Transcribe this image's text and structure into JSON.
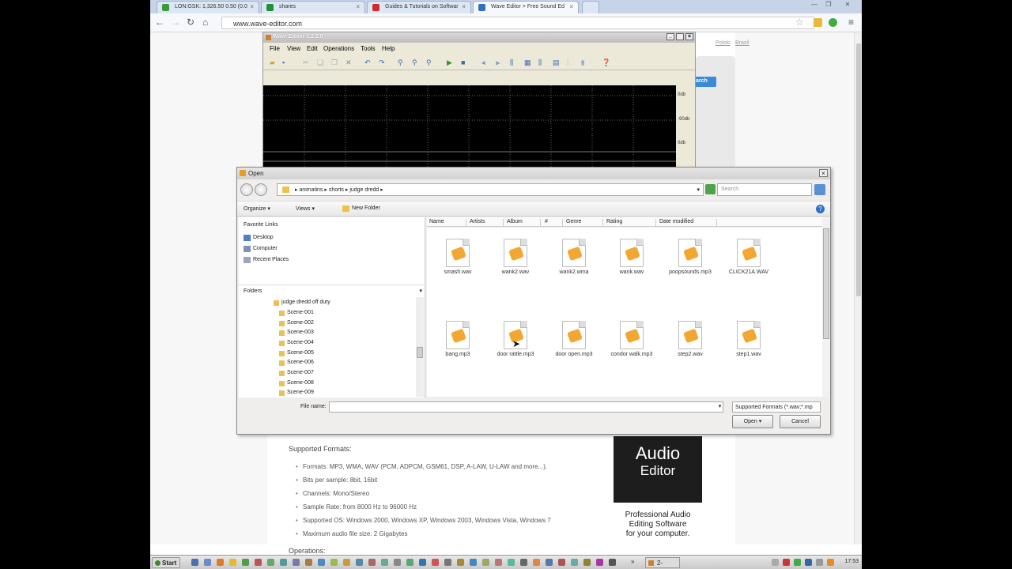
{
  "browser": {
    "tabs": [
      {
        "label": "LON:GSK: 1,326.50 0.50 (0.0",
        "favicon_color": "#3c9a3c"
      },
      {
        "label": "shares",
        "favicon_color": "#1f8f3a"
      },
      {
        "label": "Guides & Tutorials on Softwar",
        "favicon_color": "#d22a2a"
      },
      {
        "label": "Wave Editor > Free Sound Ed",
        "favicon_color": "#2f6fc9"
      }
    ],
    "url": "www.wave-editor.com",
    "page_links": {
      "lang1": "Polski",
      "lang2": "Brazil",
      "search_btn": "arch"
    }
  },
  "wave_editor": {
    "title": "Wave Editor 3.2.1.0",
    "menu": [
      "File",
      "View",
      "Edit",
      "Operations",
      "Tools",
      "Help"
    ],
    "db_labels": [
      "0db",
      "-90db",
      "0db"
    ]
  },
  "open_dialog": {
    "title": "Open",
    "breadcrumb": [
      "animatins",
      "shorts",
      "judge dredd"
    ],
    "search_placeholder": "Search",
    "commands": {
      "organize": "Organize",
      "views": "Views",
      "new_folder": "New Folder"
    },
    "favorite_links_header": "Favorite Links",
    "favorite_links": [
      "Desktop",
      "Computer",
      "Recent Places"
    ],
    "folders_header": "Folders",
    "folders": [
      "judge dredd off duty",
      "Scene-001",
      "Scene-002",
      "Scene-003",
      "Scene-004",
      "Scene-005",
      "Scene-006",
      "Scene-007",
      "Scene-008",
      "Scene-009"
    ],
    "columns": [
      "Name",
      "Artists",
      "Album",
      "#",
      "Genre",
      "Rating",
      "Date modified"
    ],
    "files_row1": [
      "smash.wav",
      "wank2.wav",
      "wank2.wma",
      "wank.wav",
      "poopsounds.mp3",
      "CLICK21A.WAV"
    ],
    "files_row2": [
      "bang.mp3",
      "door rattle.mp3",
      "door open.mp3",
      "condor walk.mp3",
      "step2.wav",
      "step1.wav"
    ],
    "file_name_label": "File name:",
    "file_name_value": "",
    "filter": "Supported Formats (*.wav;*.mp",
    "open_label": "Open",
    "cancel_label": "Cancel"
  },
  "page": {
    "supported_formats_title": "Supported Formats:",
    "features": [
      "Formats: MP3, WMA, WAV (PCM, ADPCM, GSM61, DSP, A-LAW, U-LAW and more...).",
      "Bits per sample: 8bit, 16bit",
      "Channels: Mono/Stereo",
      "Sample Rate: from 8000 Hz to 96000 Hz",
      "Supported OS: Windows 2000, Windows XP, Windows 2003, Windows Vista, Windows 7",
      "Maximum audio file size: 2 Gigabytes"
    ],
    "operations_title": "Operations:",
    "ad": {
      "title1": "Audio",
      "title2": "Editor",
      "line1": "Professional Audio",
      "line2": "Editing Software",
      "line3": "for your computer."
    }
  },
  "taskbar": {
    "start": "Start",
    "task": "2-",
    "clock": "17:53"
  }
}
